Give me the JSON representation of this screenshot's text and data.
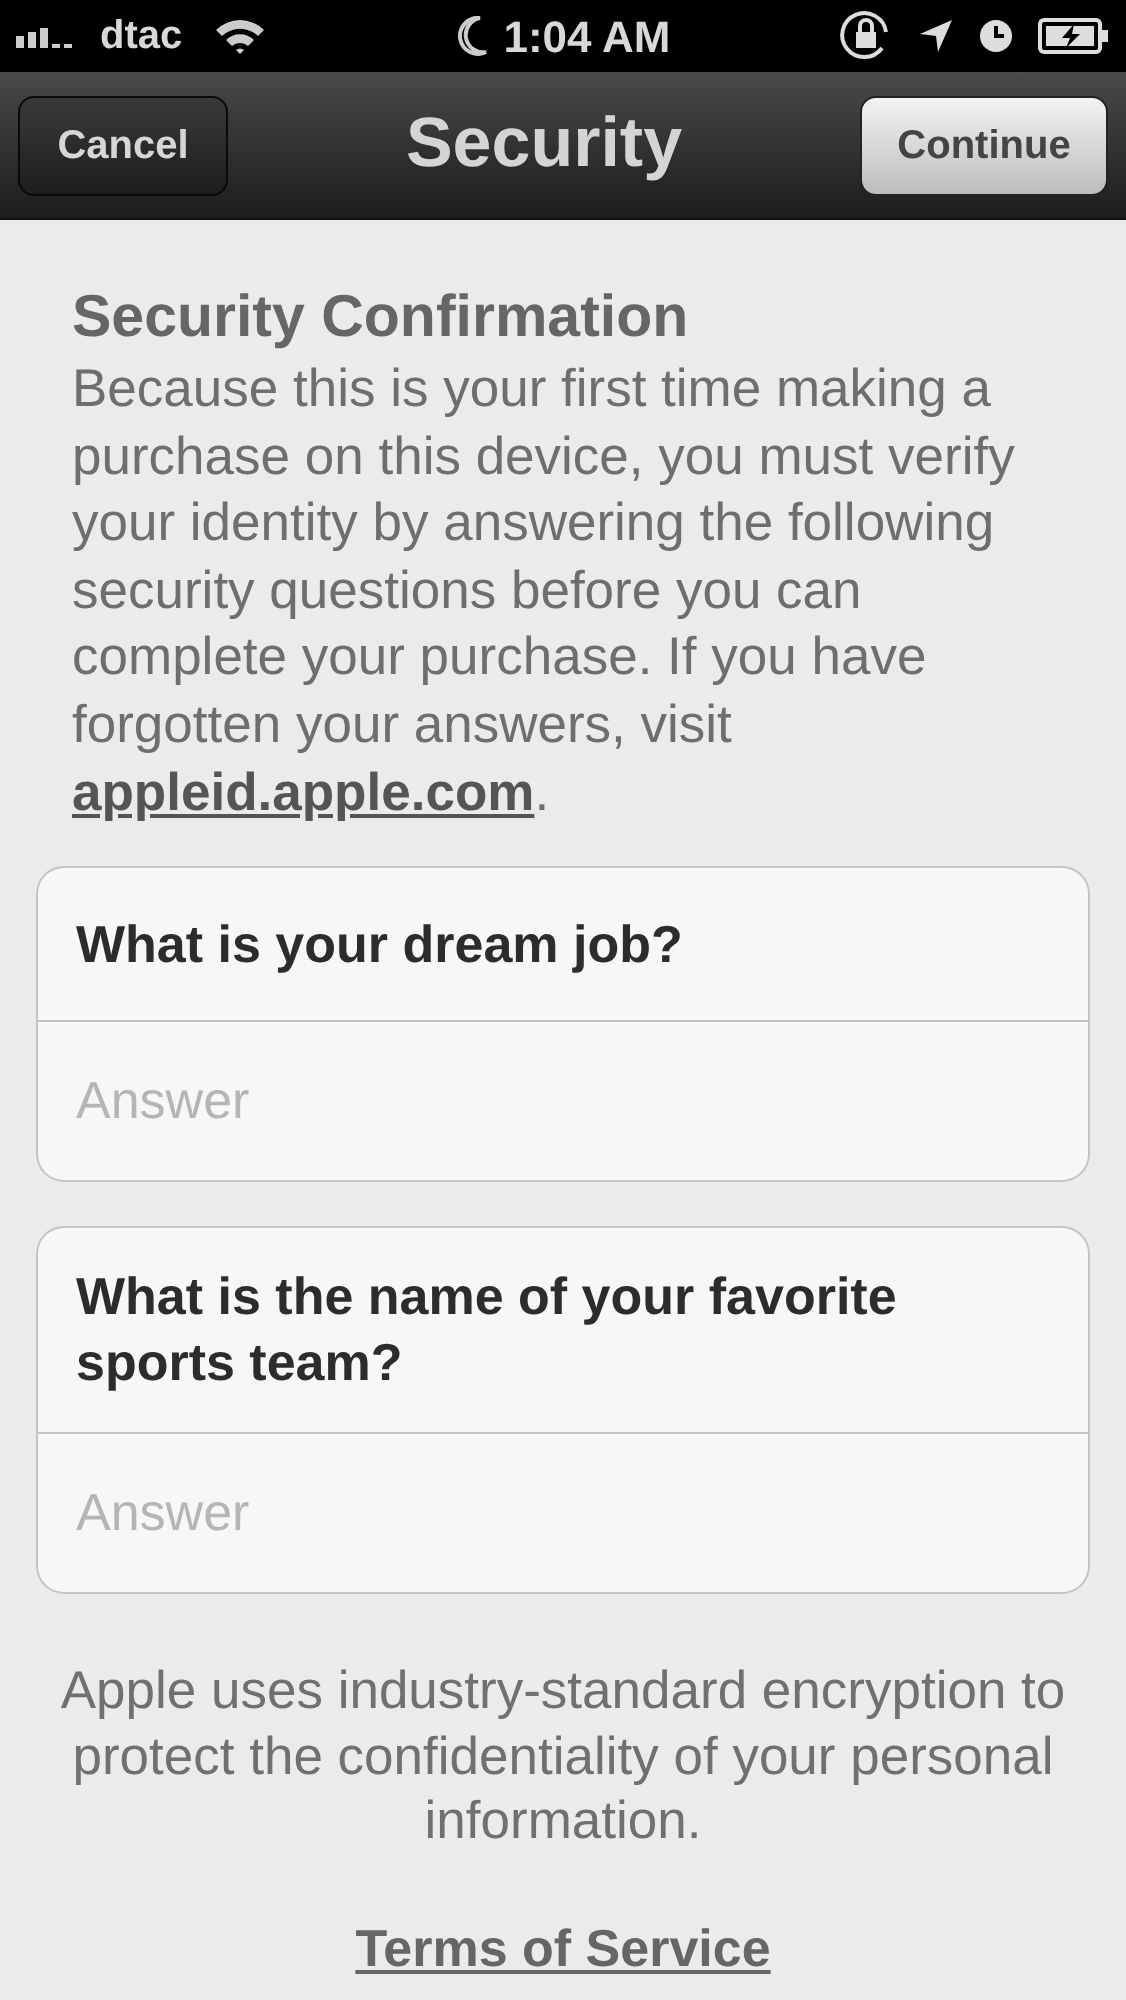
{
  "status_bar": {
    "carrier": "dtac",
    "time": "1:04 AM"
  },
  "nav_bar": {
    "title": "Security",
    "left_button": "Cancel",
    "right_button": "Continue"
  },
  "intro": {
    "heading": "Security Confirmation",
    "text": "Because this is your first time making a purchase on this device, you must verify your identity by answering the following security questions before you can complete your purchase. If you have forgotten your answers, visit ",
    "link": "appleid.apple.com",
    "text_end": "."
  },
  "questions": [
    {
      "question": "What is your dream job?",
      "placeholder": "Answer"
    },
    {
      "question": "What is the name of your favorite sports team?",
      "placeholder": "Answer"
    }
  ],
  "footer": {
    "note": "Apple uses industry-standard encryption to protect the confidentiality of your personal information.",
    "link": "Terms of Service"
  }
}
